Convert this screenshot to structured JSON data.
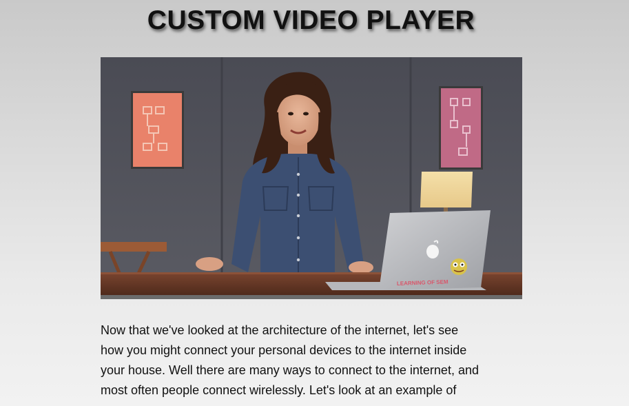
{
  "page": {
    "title": "CUSTOM VIDEO PLAYER"
  },
  "video": {
    "progress_fraction": 0,
    "laptop_logo_icon": "apple-logo-icon",
    "laptop_sticker_icon": "frog-sticker-icon",
    "laptop_sticker_text": "LEARNING OF SEM"
  },
  "transcript": {
    "lines": [
      "Now that we've looked at the architecture of the internet, let's see",
      "how you might connect your personal devices to the internet inside",
      "your house. Well there are many ways to connect to the internet, and",
      "most often people connect wirelessly. Let's look at an example of"
    ]
  },
  "colors": {
    "title_text": "#111111",
    "wall": "#4e4f57",
    "poster_left": "#e9826a",
    "poster_right": "#c06a86",
    "shirt": "#3c4f72",
    "desk": "#6b3a26"
  }
}
